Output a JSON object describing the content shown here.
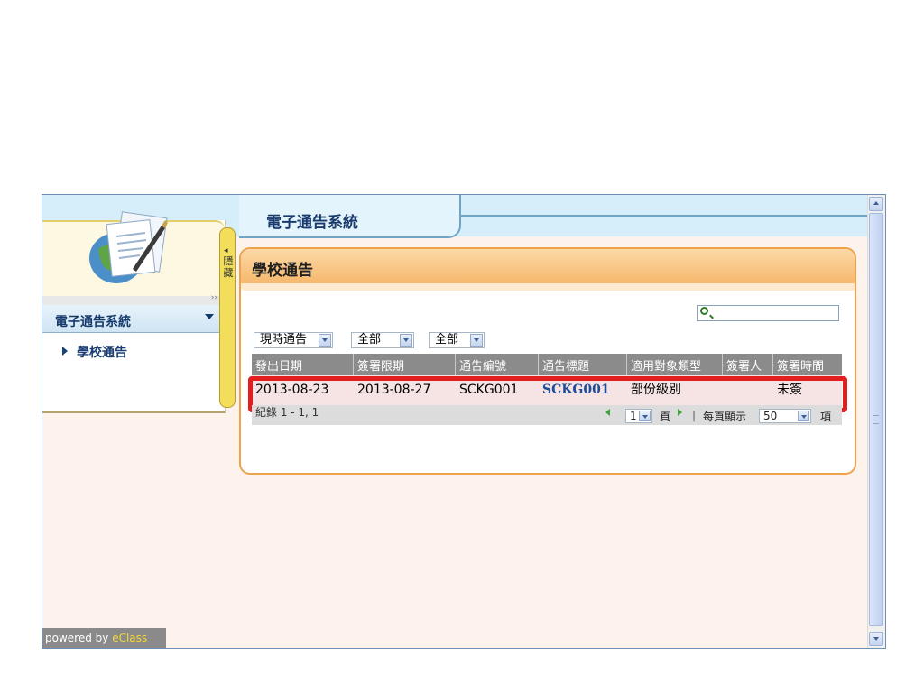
{
  "header": {
    "system_title": "電子通告系統"
  },
  "sidebar": {
    "menu_title": "電子通告系統",
    "items": [
      {
        "label": "學校通告"
      }
    ],
    "hide_label": "隱藏",
    "hide_arrow": "◂",
    "strip_glyph": "››"
  },
  "main": {
    "title": "學校通告",
    "search": {
      "value": "",
      "placeholder": ""
    },
    "filters": [
      {
        "value": "現時通告"
      },
      {
        "value": "全部"
      },
      {
        "value": "全部"
      }
    ],
    "table": {
      "columns": [
        "發出日期",
        "簽署限期",
        "通告編號",
        "通告標題",
        "適用對象類型",
        "簽署人",
        "簽署時間"
      ],
      "rows": [
        {
          "issue_date": "2013-08-23",
          "deadline": "2013-08-27",
          "notice_no": "SCKG001",
          "title": "SCKG001",
          "target_type": "部份級別",
          "signer": "",
          "sign_time": "未簽"
        }
      ],
      "records_text": "紀錄 1 - 1, 1",
      "pager": {
        "page": "1",
        "page_label": "頁",
        "per_page_label": "每頁顯示",
        "per_page": "50",
        "item_label": "項",
        "separator": "|"
      }
    }
  },
  "footer": {
    "powered_prefix": "powered by ",
    "powered_brand": "eClass"
  },
  "colors": {
    "highlight": "#e31e1e",
    "header_blue": "#183a6c",
    "panel_orange": "#eea24a",
    "link": "#1f4d97"
  },
  "icons": {
    "search": "search-icon",
    "menu": "chevron-down-icon",
    "bullet": "triangle-right-icon"
  }
}
